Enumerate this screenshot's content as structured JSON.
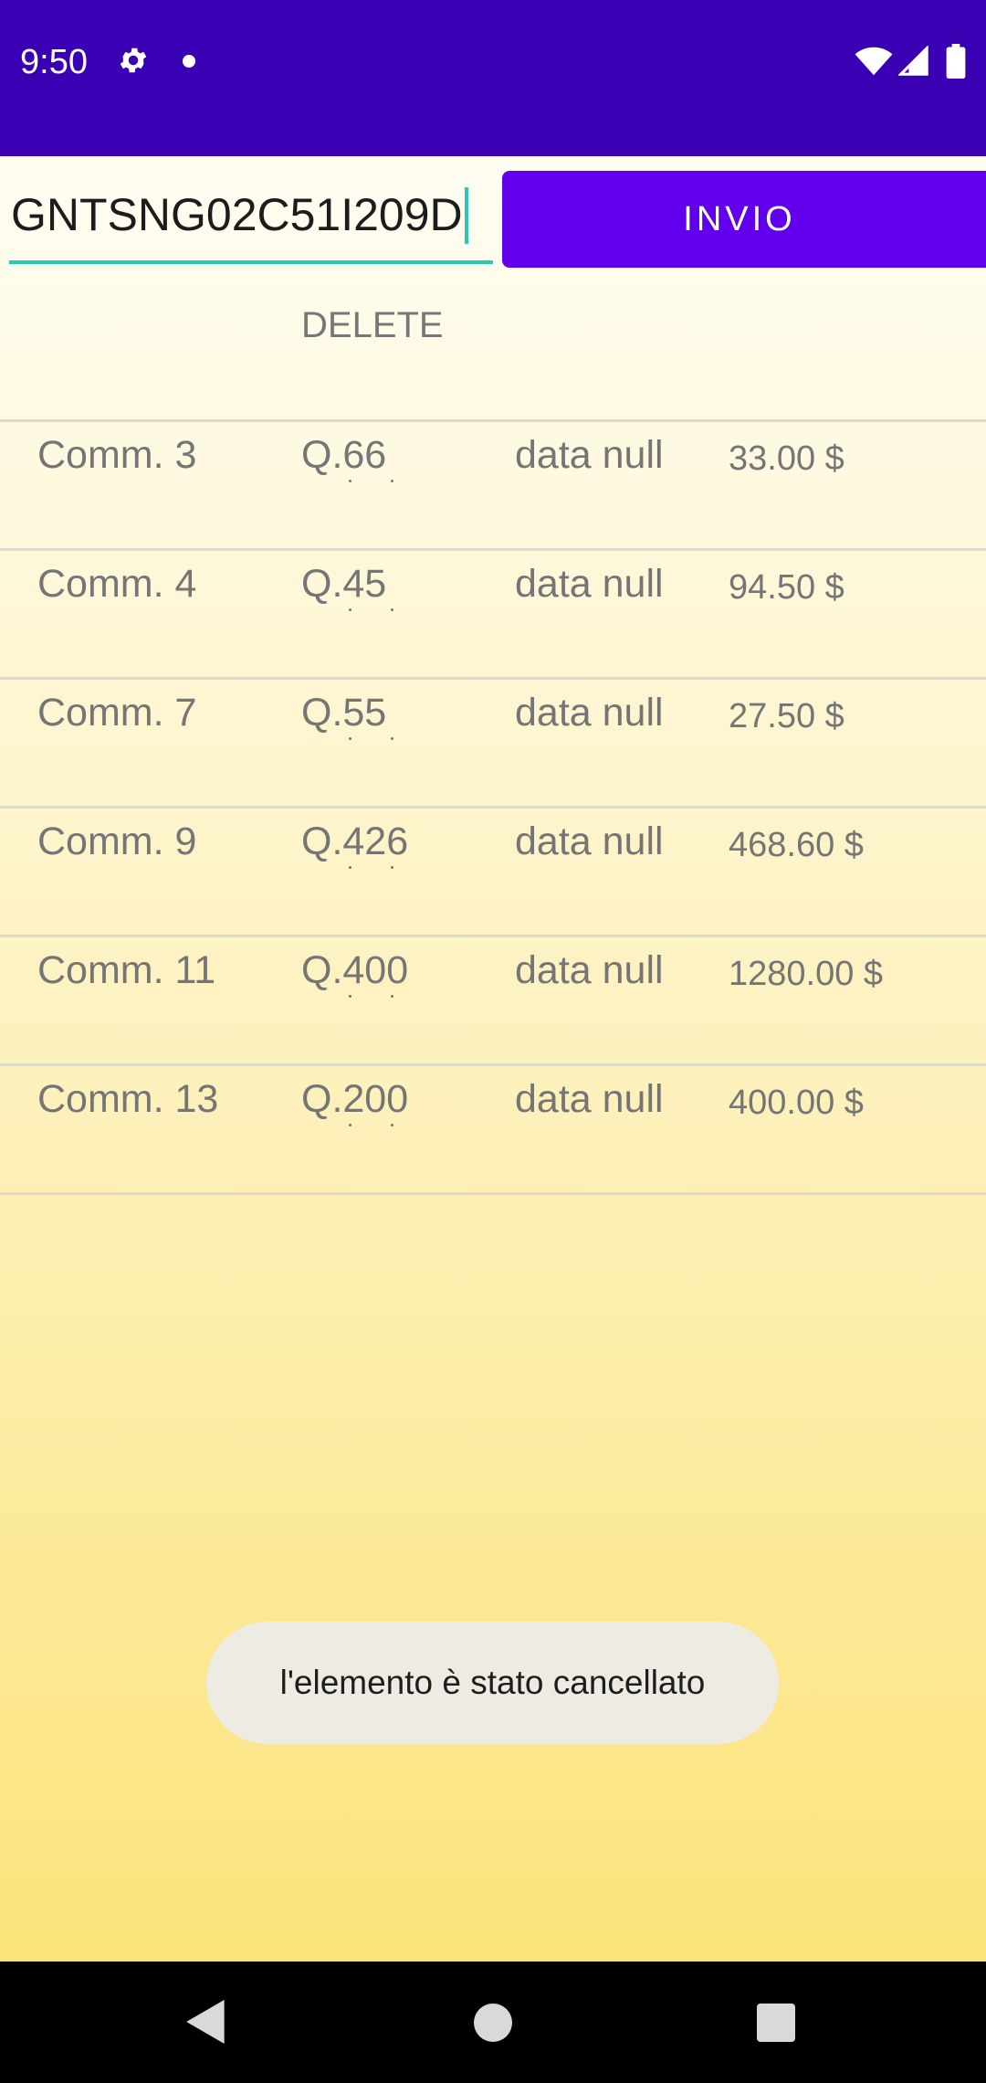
{
  "status_bar": {
    "time": "9:50",
    "icons": [
      "gear-icon",
      "notification-dot-icon",
      "wifi-icon",
      "signal-icon",
      "battery-icon"
    ]
  },
  "form": {
    "input_value": "GNTSNG02C51I209D",
    "submit_label": "INVIO",
    "delete_label": "DELETE"
  },
  "orders": [
    {
      "comm": "Comm. 3",
      "qty": "Q.66",
      "date": "data null",
      "price": "33.00 $"
    },
    {
      "comm": "Comm. 4",
      "qty": "Q.45",
      "date": "data null",
      "price": "94.50 $"
    },
    {
      "comm": "Comm. 7",
      "qty": "Q.55",
      "date": "data null",
      "price": "27.50 $"
    },
    {
      "comm": "Comm. 9",
      "qty": "Q.426",
      "date": "data null",
      "price": "468.60 $"
    },
    {
      "comm": "Comm. 11",
      "qty": "Q.400",
      "date": "data null",
      "price": "1280.00 $"
    },
    {
      "comm": "Comm. 13",
      "qty": "Q.200",
      "date": "data null",
      "price": "400.00 $"
    }
  ],
  "toast": {
    "message": "l'elemento è stato cancellato"
  },
  "colors": {
    "status_bar": "#3a00b4",
    "primary": "#6200ee",
    "accent": "#26c9b5"
  },
  "nav_bar": {
    "icons": [
      "back-icon",
      "home-icon",
      "recents-icon"
    ]
  }
}
